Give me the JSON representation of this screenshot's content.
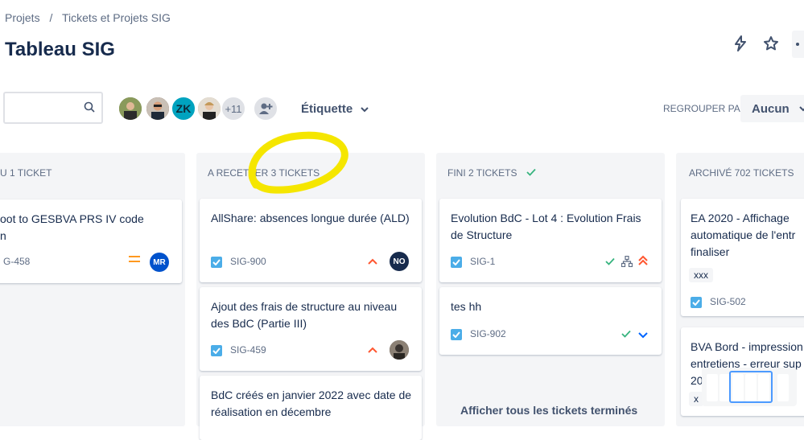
{
  "breadcrumb": {
    "item1": "Projets",
    "sep": "/",
    "item2": "Tickets et Projets SIG"
  },
  "page_title": "Tableau SIG",
  "toolbar": {
    "search_placeholder": "",
    "avatar_initials": "ZK",
    "avatar_more": "+11",
    "label_filter": "Étiquette",
    "group_by_label": "REGROUPER PAR",
    "group_by_value": "Aucun"
  },
  "colors": {
    "accent_blue": "#0052cc",
    "checkbox": "#4bade8",
    "priority_high": "#ff5630",
    "priority_medium": "#ff991f",
    "done_green": "#36b37e",
    "annotation": "#f5e600"
  },
  "columns": [
    {
      "header": "U 1 TICKET",
      "cards": [
        {
          "title": "oot to GESBVA PRS IV code\nn",
          "key": "G-458",
          "avatar": "MR",
          "priority": "medium"
        }
      ]
    },
    {
      "header": "A RECETTER 3 TICKETS",
      "cards": [
        {
          "title": "AllShare: absences longue durée (ALD)",
          "key": "SIG-900",
          "avatar": "NO",
          "priority": "high"
        },
        {
          "title": "Ajout des frais de structure au niveau des BdC (Partie III)",
          "key": "SIG-459",
          "avatar": "",
          "priority": "high"
        },
        {
          "title": "BdC créés en janvier 2022 avec date de réalisation en décembre",
          "key": "",
          "avatar": "",
          "priority": ""
        }
      ]
    },
    {
      "header": "FINI 2 TICKETS",
      "cards": [
        {
          "title": "Evolution BdC - Lot 4 : Evolution Frais de Structure",
          "key": "SIG-1",
          "avatar": "",
          "priority": "highest"
        },
        {
          "title": "tes hh",
          "key": "SIG-902",
          "avatar": "",
          "priority": "low"
        }
      ],
      "show_all": "Afficher tous les tickets terminés"
    },
    {
      "header": "ARCHIVÉ 702 TICKETS",
      "cards": [
        {
          "title": "EA 2020 - Affichage automatique de l'entr finaliser",
          "tag": "xxx",
          "key": "SIG-502"
        },
        {
          "title": "BVA Bord - impression entretiens - erreur sup 20",
          "tag": "x"
        }
      ]
    }
  ]
}
